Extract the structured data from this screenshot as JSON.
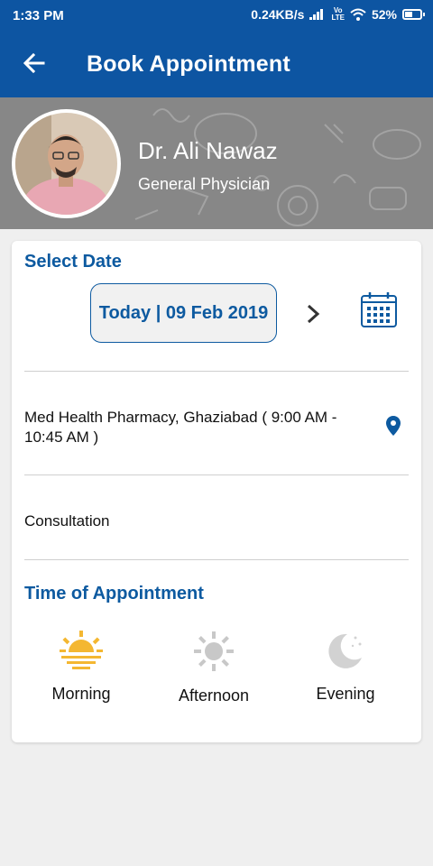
{
  "status": {
    "time": "1:33 PM",
    "speed": "0.24KB/s",
    "volte": "Vo LTE",
    "battery": "52%",
    "battery_level": 0.52
  },
  "appbar": {
    "title": "Book Appointment",
    "back_icon": "arrow-back-icon"
  },
  "doctor": {
    "name": "Dr. Ali Nawaz",
    "specialty": "General Physician"
  },
  "booking": {
    "select_date_label": "Select Date",
    "date_value": "Today | 09 Feb 2019",
    "location": "Med Health Pharmacy, Ghaziabad ( 9:00 AM - 10:45 AM )",
    "service": "Consultation",
    "time_label": "Time of Appointment",
    "slots": [
      {
        "label": "Morning",
        "icon": "sunrise-icon",
        "color": "#f4b731"
      },
      {
        "label": "Afternoon",
        "icon": "sun-icon",
        "color": "#c8c8c8"
      },
      {
        "label": "Evening",
        "icon": "moon-icon",
        "color": "#d2d2d2"
      }
    ]
  },
  "colors": {
    "primary": "#0d55a2",
    "accent_text": "#0d5aa0",
    "background": "#efefef"
  }
}
